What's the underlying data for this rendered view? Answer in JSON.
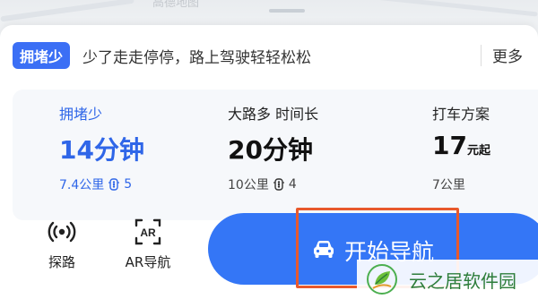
{
  "map": {
    "watermark": "高德地图"
  },
  "tip": {
    "badge": "拥堵少",
    "text": "少了走走停停，路上驾驶轻轻松松",
    "more": "更多"
  },
  "routes": [
    {
      "tag": "拥堵少",
      "time": "14分钟",
      "distance": "7.4公里",
      "lights": "5",
      "selected": true
    },
    {
      "tag": "大路多 时间长",
      "time": "20分钟",
      "distance": "10公里",
      "lights": "4",
      "selected": false
    },
    {
      "tag": "打车方案",
      "time_main": "17",
      "time_suffix": "元起",
      "distance": "7公里",
      "selected": false
    }
  ],
  "actions": {
    "probe_label": "探路",
    "ar_label": "AR导航",
    "ar_icon_text": "AR"
  },
  "navigation": {
    "start_label": "开始导航"
  },
  "watermark": {
    "text": "云之居软件园"
  },
  "colors": {
    "accent": "#3476f6",
    "highlight": "#e8592c",
    "selected_text": "#2f66e8",
    "watermark_green": "#2d7d3a"
  },
  "icons": {
    "probe": "signal-radar-icon",
    "ar": "ar-scan-icon",
    "car": "car-icon",
    "traffic_light": "traffic-light-icon",
    "watermark_logo": "leaf-logo-icon"
  }
}
